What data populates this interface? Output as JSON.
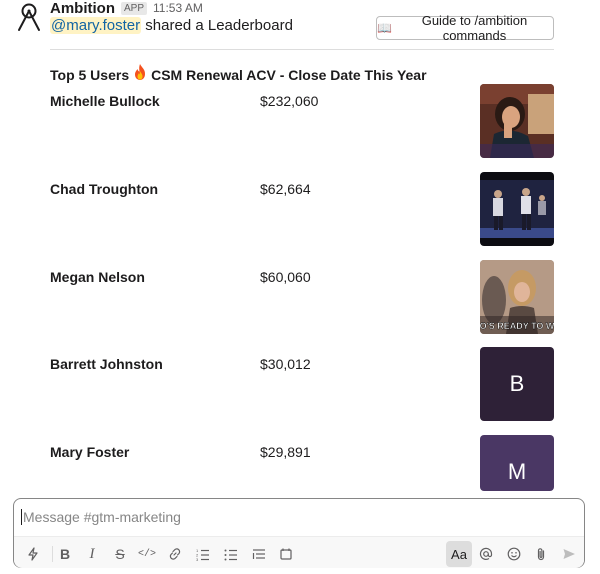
{
  "message": {
    "app_name": "Ambition",
    "app_badge": "APP",
    "timestamp": "11:53 AM",
    "mention": "@mary.foster",
    "action_text": " shared a Leaderboard",
    "guide_button": "Guide to /ambition commands",
    "guide_icon": "open-book-icon"
  },
  "leaderboard": {
    "title_prefix": "Top 5 Users",
    "title_suffix": "CSM Renewal ACV - Close Date This Year",
    "rows": [
      {
        "name": "Michelle Bullock",
        "amount": "$232,060",
        "thumb": "gif"
      },
      {
        "name": "Chad Troughton",
        "amount": "$62,664",
        "thumb": "gif"
      },
      {
        "name": "Megan Nelson",
        "amount": "$60,060",
        "thumb": "gif",
        "caption": "O'S READY TO W"
      },
      {
        "name": "Barrett Johnston",
        "amount": "$30,012",
        "thumb": "avatar",
        "letter": "B",
        "color": "#2e2137"
      },
      {
        "name": "Mary Foster",
        "amount": "$29,891",
        "thumb": "avatar",
        "letter": "M",
        "color": "#4a3764"
      }
    ]
  },
  "composer": {
    "placeholder": "Message #gtm-marketing",
    "format_button": "Aa"
  }
}
